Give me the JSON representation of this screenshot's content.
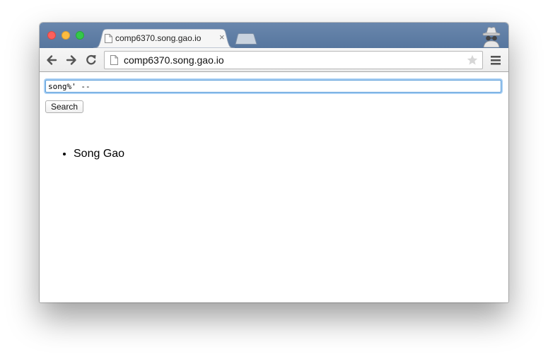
{
  "browser": {
    "tab": {
      "title": "comp6370.song.gao.io",
      "close_glyph": "×",
      "icon": "page-icon"
    },
    "omnibox": {
      "url": "comp6370.song.gao.io",
      "icon": "page-icon",
      "bookmark_icon": "star-icon"
    },
    "toolbar": {
      "back_icon": "arrow-left-icon",
      "forward_icon": "arrow-right-icon",
      "reload_icon": "reload-icon",
      "menu_icon": "hamburger-menu-icon"
    },
    "incognito_icon": "incognito-icon",
    "window_controls": [
      "close",
      "minimize",
      "maximize"
    ],
    "colors": {
      "titlebar": "#5f7ea6",
      "close": "#fc605c",
      "minimize": "#fdbc40",
      "maximize": "#34c84a",
      "focus_ring": "#5b9dd9"
    }
  },
  "page": {
    "search": {
      "value": "song%' --"
    },
    "search_button_label": "Search",
    "results": [
      "Song Gao"
    ]
  }
}
